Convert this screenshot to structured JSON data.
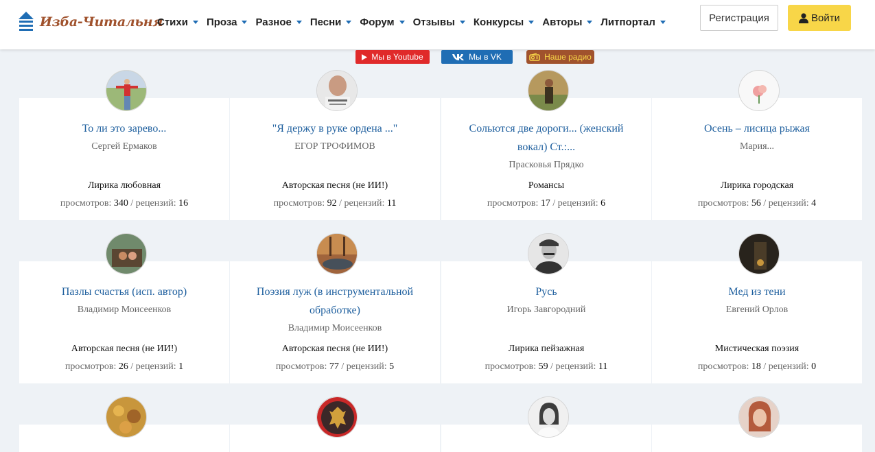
{
  "site": {
    "logo_text": "Изба-Читальня"
  },
  "nav": [
    "Стихи",
    "Проза",
    "Разное",
    "Песни",
    "Форум",
    "Отзывы",
    "Конкурсы",
    "Авторы",
    "Литпортал"
  ],
  "auth": {
    "register": "Регистрация",
    "login": "Войти"
  },
  "social": {
    "youtube": "Мы в Youtube",
    "vk": "Мы в VK",
    "radio": "Наше радио"
  },
  "labels": {
    "views": "просмотров:",
    "reviews": "рецензий:"
  },
  "cards": [
    {
      "title": "То ли это зарево...",
      "author": "Сергей Ермаков",
      "genre": "Лирика любовная",
      "views": "340",
      "reviews": "16"
    },
    {
      "title": "\"Я держу в руке ордена ...\"",
      "author": "ЕГОР ТРОФИМОВ",
      "genre": "Авторская песня (не ИИ!)",
      "views": "92",
      "reviews": "11"
    },
    {
      "title": "Сольются две дороги... (женский вокал) Ст.:...",
      "author": "Прасковья Прядко",
      "genre": "Романсы",
      "views": "17",
      "reviews": "6"
    },
    {
      "title": "Осень – лисица рыжая",
      "author": "Мария...",
      "genre": "Лирика городская",
      "views": "56",
      "reviews": "4"
    },
    {
      "title": "Пазлы счастья (исп. автор)",
      "author": "Владимир Моисеенков",
      "genre": "Авторская песня (не ИИ!)",
      "views": "26",
      "reviews": "1"
    },
    {
      "title": "Поэзия луж (в инструментальной обработке)",
      "author": "Владимир Моисеенков",
      "genre": "Авторская песня (не ИИ!)",
      "views": "77",
      "reviews": "5"
    },
    {
      "title": "Русь",
      "author": "Игорь Завгородний",
      "genre": "Лирика пейзажная",
      "views": "59",
      "reviews": "11"
    },
    {
      "title": "Мед из тени",
      "author": "Евгений Орлов",
      "genre": "Мистическая поэзия",
      "views": "18",
      "reviews": "0"
    }
  ],
  "colors": {
    "link": "#1e5f9e",
    "accent": "#f8d648",
    "brand": "#a0522d",
    "youtube": "#e02a2a",
    "vk": "#1f6db4"
  }
}
